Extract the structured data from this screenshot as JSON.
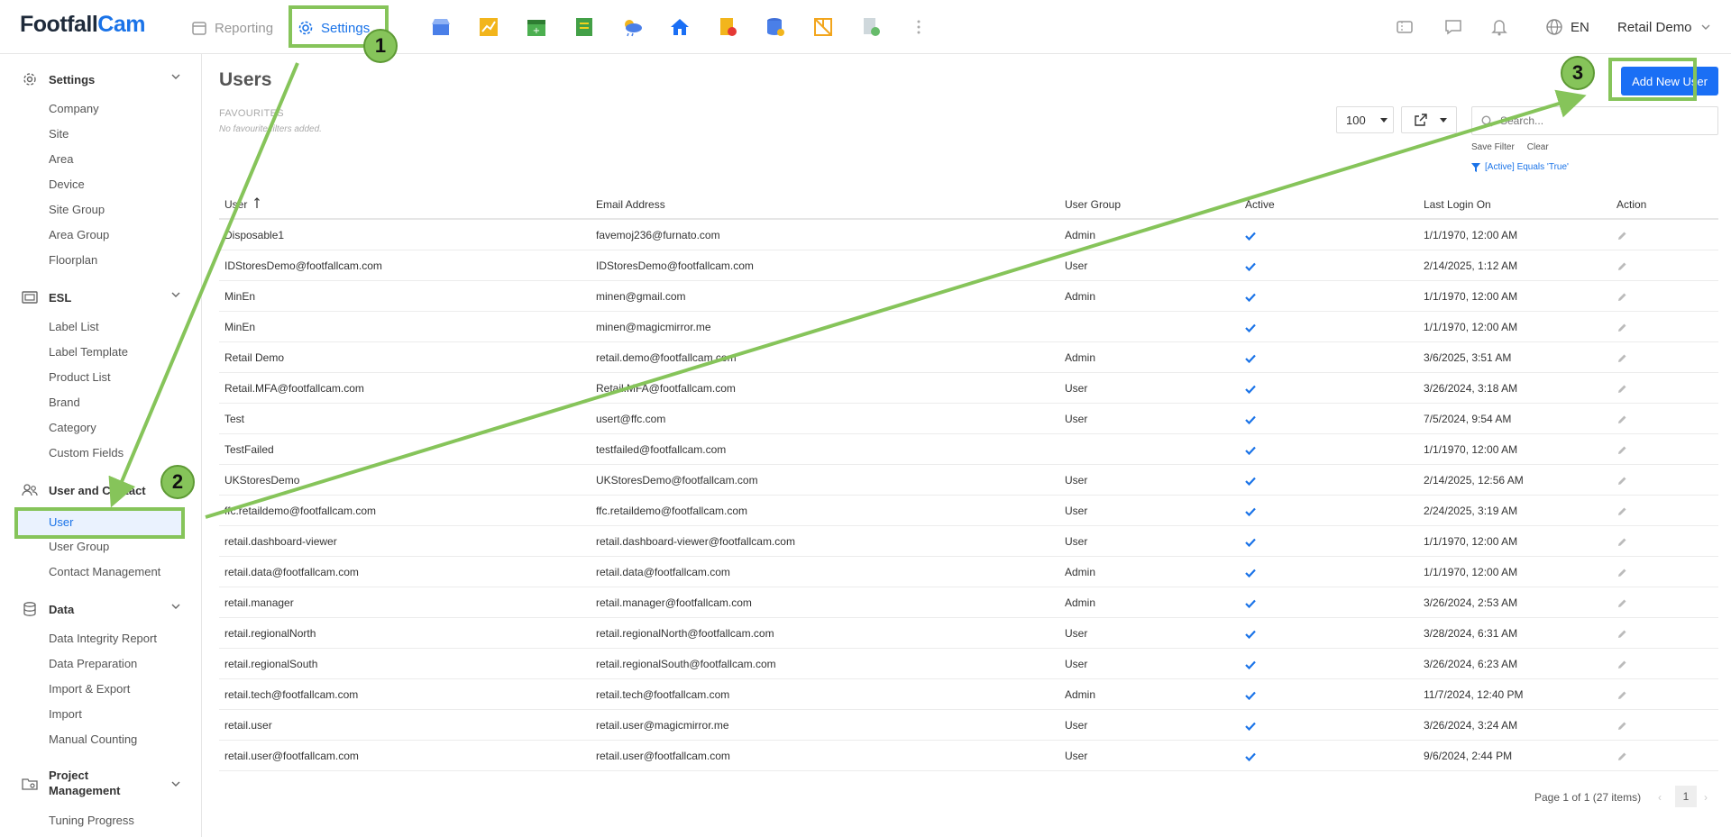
{
  "app": {
    "logo_part1": "Footfall",
    "logo_part2": "Cam"
  },
  "topbar": {
    "reporting_label": "Reporting",
    "settings_label": "Settings",
    "module_icons": [
      "store-icon",
      "chart-icon",
      "calendar-icon",
      "report-icon",
      "weather-icon",
      "home-icon",
      "alert-doc-icon",
      "database-icon",
      "layout-icon",
      "export-doc-icon",
      "more-icon"
    ],
    "language": "EN",
    "user_name": "Retail Demo"
  },
  "sidebar": {
    "sections": [
      {
        "label": "Settings",
        "items": [
          "Company",
          "Site",
          "Area",
          "Device",
          "Site Group",
          "Area Group",
          "Floorplan"
        ]
      },
      {
        "label": "ESL",
        "items": [
          "Label List",
          "Label Template",
          "Product List",
          "Brand",
          "Category",
          "Custom Fields"
        ]
      },
      {
        "label": "User and Contact",
        "items": [
          "User",
          "User Group",
          "Contact Management"
        ]
      },
      {
        "label": "Data",
        "items": [
          "Data Integrity Report",
          "Data Preparation",
          "Import & Export",
          "Import",
          "Manual Counting"
        ]
      },
      {
        "label_line1": "Project",
        "label_line2": "Management",
        "items": [
          "Tuning Progress"
        ]
      }
    ]
  },
  "main": {
    "title": "Users",
    "favourites_title": "FAVOURITES",
    "favourites_note": "No favourite filters added.",
    "add_button": "Add New User",
    "page_size": "100",
    "search_placeholder": "Search...",
    "save_filter": "Save Filter",
    "clear": "Clear",
    "active_filter": "[Active] Equals 'True'",
    "columns": {
      "user": "User",
      "email": "Email Address",
      "group": "User Group",
      "active": "Active",
      "last_login": "Last Login On",
      "action": "Action"
    },
    "rows": [
      {
        "user": "Disposable1",
        "email": "favemoj236@furnato.com",
        "group": "Admin",
        "login": "1/1/1970, 12:00 AM"
      },
      {
        "user": "IDStoresDemo@footfallcam.com",
        "email": "IDStoresDemo@footfallcam.com",
        "group": "User",
        "login": "2/14/2025, 1:12 AM"
      },
      {
        "user": "MinEn",
        "email": "minen@gmail.com",
        "group": "Admin",
        "login": "1/1/1970, 12:00 AM"
      },
      {
        "user": "MinEn",
        "email": "minen@magicmirror.me",
        "group": "",
        "login": "1/1/1970, 12:00 AM"
      },
      {
        "user": "Retail Demo",
        "email": "retail.demo@footfallcam.com",
        "group": "Admin",
        "login": "3/6/2025, 3:51 AM"
      },
      {
        "user": "Retail.MFA@footfallcam.com",
        "email": "Retail.MFA@footfallcam.com",
        "group": "User",
        "login": "3/26/2024, 3:18 AM"
      },
      {
        "user": "Test",
        "email": "usert@ffc.com",
        "group": "User",
        "login": "7/5/2024, 9:54 AM"
      },
      {
        "user": "TestFailed",
        "email": "testfailed@footfallcam.com",
        "group": "",
        "login": "1/1/1970, 12:00 AM"
      },
      {
        "user": "UKStoresDemo",
        "email": "UKStoresDemo@footfallcam.com",
        "group": "User",
        "login": "2/14/2025, 12:56 AM"
      },
      {
        "user": "ffc.retaildemo@footfallcam.com",
        "email": "ffc.retaildemo@footfallcam.com",
        "group": "User",
        "login": "2/24/2025, 3:19 AM"
      },
      {
        "user": "retail.dashboard-viewer",
        "email": "retail.dashboard-viewer@footfallcam.com",
        "group": "User",
        "login": "1/1/1970, 12:00 AM"
      },
      {
        "user": "retail.data@footfallcam.com",
        "email": "retail.data@footfallcam.com",
        "group": "Admin",
        "login": "1/1/1970, 12:00 AM"
      },
      {
        "user": "retail.manager",
        "email": "retail.manager@footfallcam.com",
        "group": "Admin",
        "login": "3/26/2024, 2:53 AM"
      },
      {
        "user": "retail.regionalNorth",
        "email": "retail.regionalNorth@footfallcam.com",
        "group": "User",
        "login": "3/28/2024, 6:31 AM"
      },
      {
        "user": "retail.regionalSouth",
        "email": "retail.regionalSouth@footfallcam.com",
        "group": "User",
        "login": "3/26/2024, 6:23 AM"
      },
      {
        "user": "retail.tech@footfallcam.com",
        "email": "retail.tech@footfallcam.com",
        "group": "Admin",
        "login": "11/7/2024, 12:40 PM"
      },
      {
        "user": "retail.user",
        "email": "retail.user@magicmirror.me",
        "group": "User",
        "login": "3/26/2024, 3:24 AM"
      },
      {
        "user": "retail.user@footfallcam.com",
        "email": "retail.user@footfallcam.com",
        "group": "User",
        "login": "9/6/2024, 2:44 PM"
      }
    ],
    "pagination_text": "Page 1 of 1 (27 items)",
    "current_page": "1"
  },
  "annotations": {
    "step1": "1",
    "step2": "2",
    "step3": "3",
    "color": "#86c45a"
  }
}
